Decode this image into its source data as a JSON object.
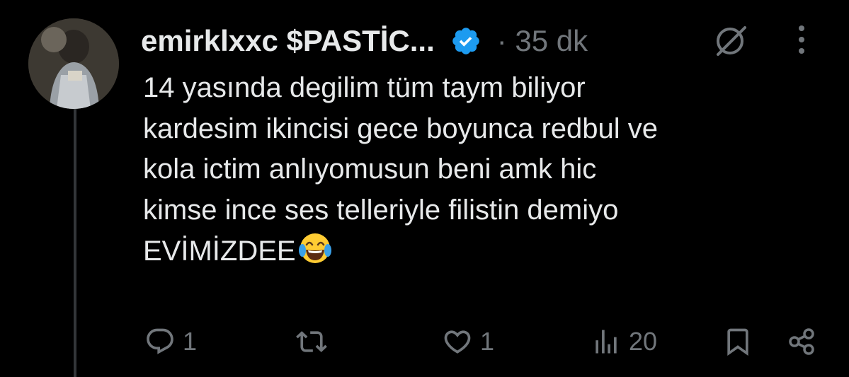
{
  "tweet": {
    "display_name": "emirklxxc $PASTİC...",
    "time_label": "· 35 dk",
    "text": "14 yasında degilim tüm taym biliyor\nkardesim ikincisi gece boyunca redbul ve\nkola ictim anlıyomusun beni amk hic\nkimse ince ses telleriyle filistin demiyo\nEVİMİZDEE",
    "emoji": "face-with-tears-of-joy"
  },
  "actions": {
    "reply_count": "1",
    "retweet_count": "",
    "like_count": "1",
    "views_count": "20"
  },
  "colors": {
    "background": "#000000",
    "text": "#e7e9ea",
    "muted": "#71767b",
    "verified": "#1d9bf0",
    "thread_line": "#333639"
  }
}
